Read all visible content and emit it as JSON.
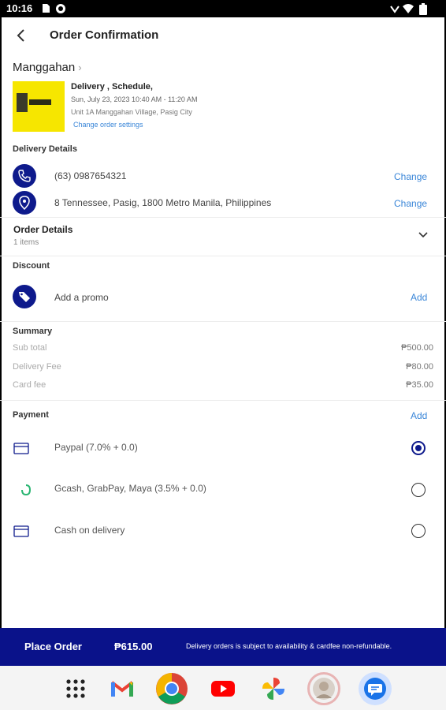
{
  "status_bar": {
    "time": "10:16"
  },
  "header": {
    "title": "Order Confirmation"
  },
  "store": {
    "name": "Manggahan",
    "chevron": "›"
  },
  "order": {
    "type": "Delivery , Schedule,",
    "date": "Sun, July 23, 2023 10:40 AM - 11:20 AM",
    "address": "Unit 1A Manggahan Village, Pasig City",
    "change_label": "Change order settings"
  },
  "delivery_details": {
    "label": "Delivery Details",
    "phone": "(63) 0987654321",
    "location": "8 Tennessee, Pasig, 1800 Metro Manila, Philippines",
    "change_label": "Change"
  },
  "order_details": {
    "title": "Order Details",
    "items": "1 items"
  },
  "discount": {
    "label": "Discount",
    "promo_text": "Add a promo",
    "add_label": "Add"
  },
  "summary": {
    "label": "Summary",
    "rows": [
      {
        "label": "Sub total",
        "value": "₱500.00"
      },
      {
        "label": "Delivery Fee",
        "value": "₱80.00"
      },
      {
        "label": "Card fee",
        "value": "₱35.00"
      }
    ]
  },
  "payment": {
    "label": "Payment",
    "add_label": "Add",
    "methods": [
      {
        "label": "Paypal (7.0% + 0.0)",
        "icon": "card-icon",
        "selected": true
      },
      {
        "label": "Gcash, GrabPay, Maya (3.5% + 0.0)",
        "icon": "ewallet-icon",
        "selected": false
      },
      {
        "label": "Cash on delivery",
        "icon": "card-icon",
        "selected": false
      }
    ]
  },
  "footer": {
    "place_order": "Place Order",
    "total": "₱615.00",
    "note": "Delivery orders is subject to availability & cardfee non-refundable."
  },
  "dock": {
    "apps": [
      "app-drawer-icon",
      "gmail-icon",
      "chrome-icon",
      "youtube-icon",
      "photos-icon",
      "contact-avatar-icon",
      "messages-icon"
    ]
  },
  "colors": {
    "primary": "#0a128a",
    "link": "#3a86d8",
    "thumb": "#f6e600"
  }
}
